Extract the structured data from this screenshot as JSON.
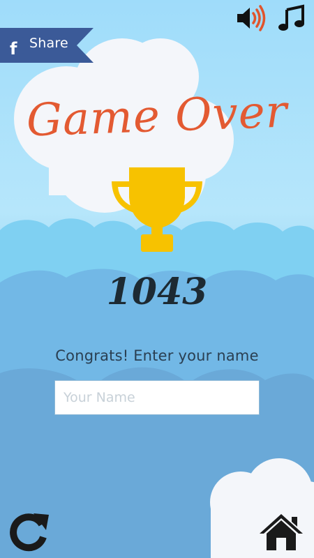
{
  "header": {
    "share_label": "Share",
    "share_icon": "facebook-icon",
    "sound_icon": "speaker-icon",
    "music_icon": "music-note-icon"
  },
  "result": {
    "title": "Game Over",
    "trophy_icon": "trophy-icon",
    "score": "1043"
  },
  "entry": {
    "prompt": "Congrats! Enter your name",
    "name_value": "",
    "name_placeholder": "Your Name"
  },
  "footer": {
    "restart_icon": "restart-icon",
    "home_icon": "home-icon"
  },
  "colors": {
    "title": "#e35a32",
    "trophy": "#f7c200",
    "share_tab": "#3b5a98",
    "sound_waves": "#e0542c",
    "score": "#1d2a33"
  }
}
